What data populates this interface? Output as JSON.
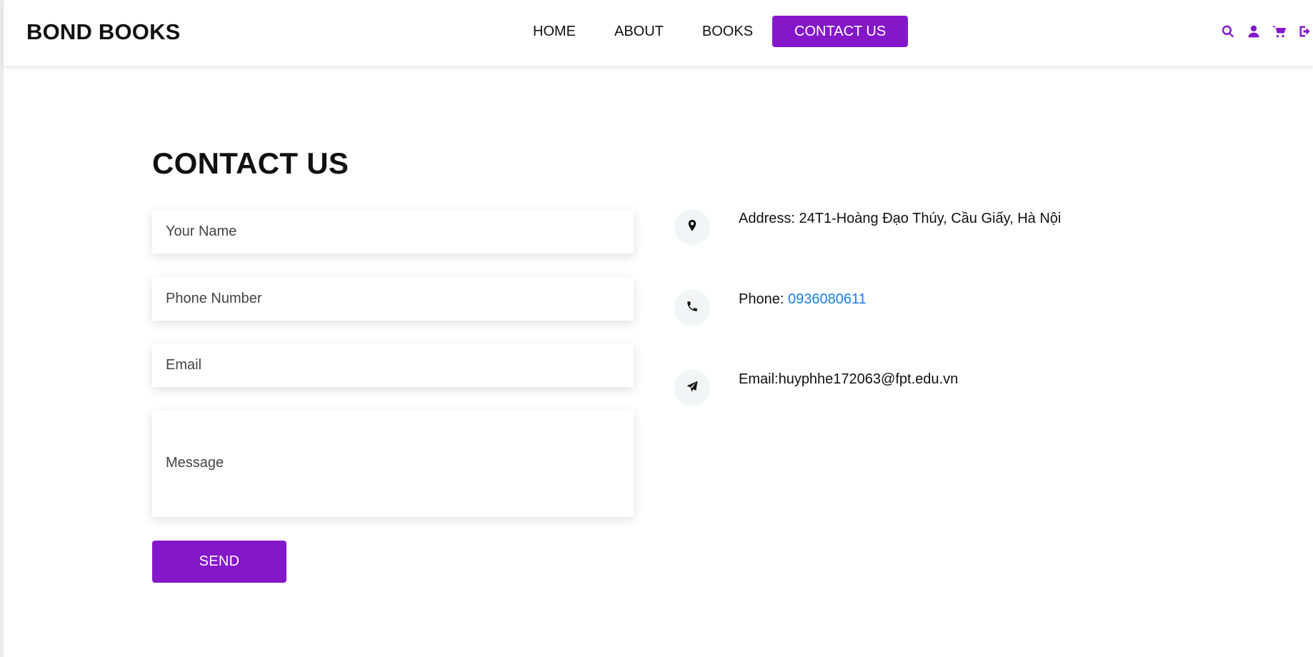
{
  "header": {
    "logo": "BOND BOOKS",
    "nav": [
      {
        "label": "HOME"
      },
      {
        "label": "ABOUT"
      },
      {
        "label": "BOOKS"
      },
      {
        "label": "CONTACT US",
        "active": true
      }
    ],
    "icons": [
      "search-icon",
      "user-icon",
      "cart-icon",
      "logout-icon"
    ],
    "accent_color": "#8418c9"
  },
  "contact": {
    "title": "CONTACT US",
    "form": {
      "name_placeholder": "Your Name",
      "phone_placeholder": "Phone Number",
      "email_placeholder": "Email",
      "message_placeholder": "Message",
      "send_label": "SEND"
    },
    "info": {
      "address_text": "Address: 24T1-Hoàng Đạo Thúy, Cầu Giấy, Hà Nội",
      "phone_label": "Phone: ",
      "phone_number": "0936080611",
      "email_text": "Email:huyphhe172063@fpt.edu.vn",
      "link_color": "#1d7bf0"
    }
  }
}
